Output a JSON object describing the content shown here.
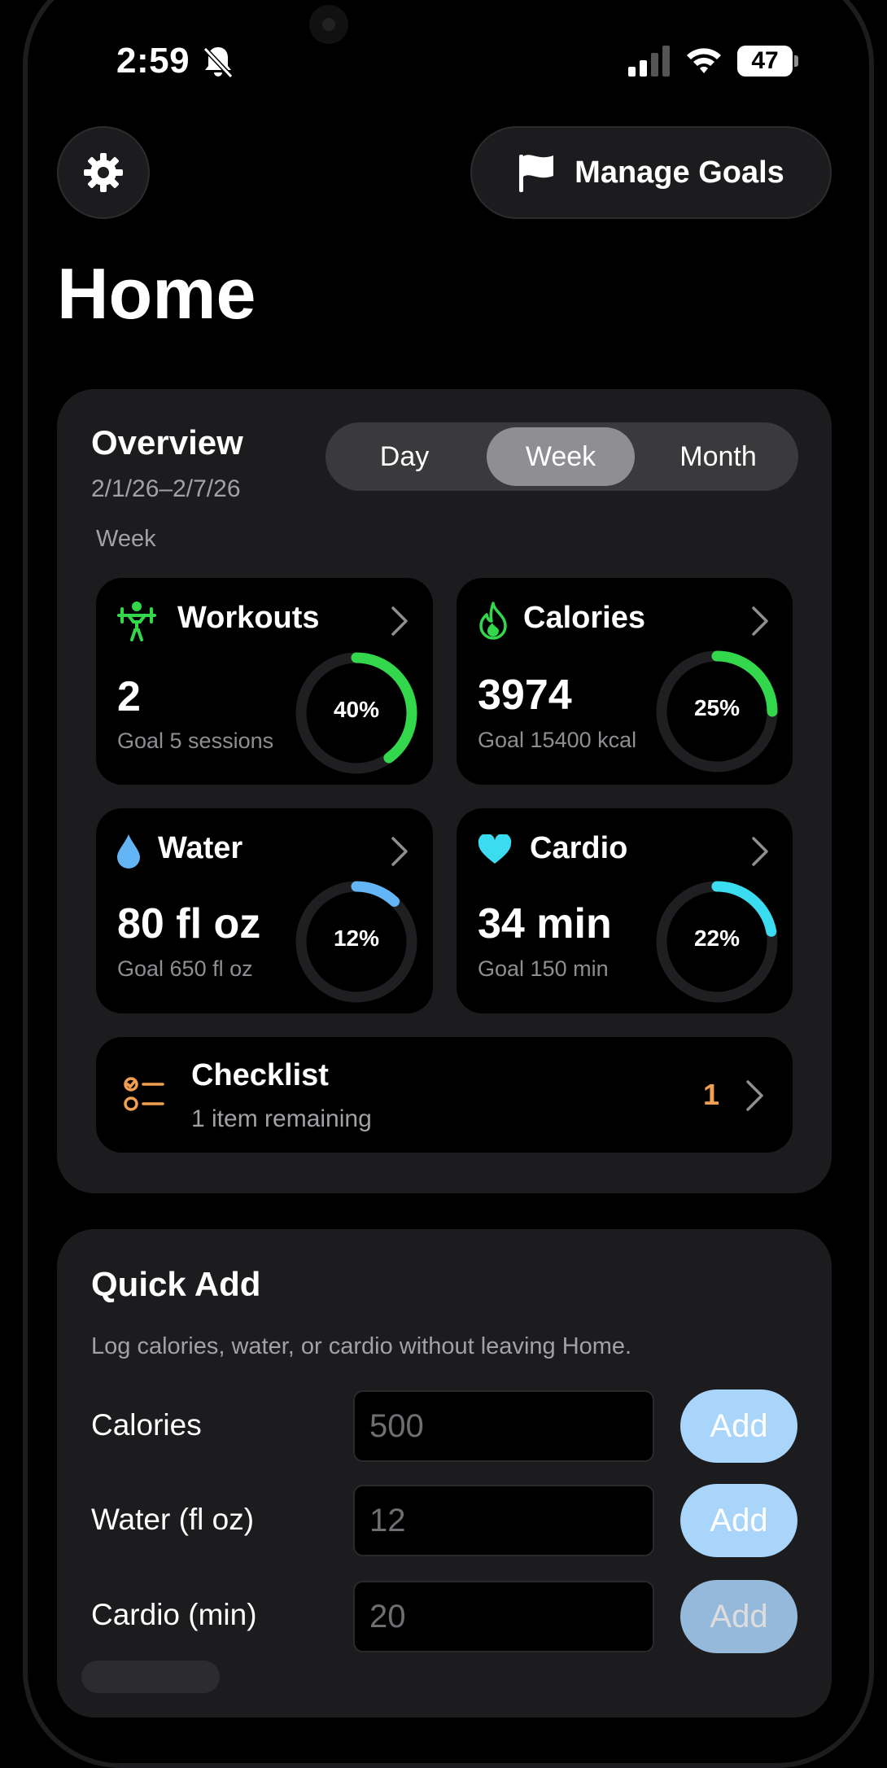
{
  "status_bar": {
    "time": "2:59",
    "battery": "47"
  },
  "header": {
    "settings_icon": "gear-icon",
    "manage_goals_label": "Manage Goals",
    "manage_goals_icon": "flag-icon"
  },
  "page_title": "Home",
  "overview": {
    "title": "Overview",
    "date_range": "2/1/26–2/7/26",
    "period_label": "Week",
    "segments": [
      "Day",
      "Week",
      "Month"
    ],
    "selected_segment": "Week",
    "tiles": {
      "workouts": {
        "title": "Workouts",
        "value": "2",
        "goal": "Goal 5 sessions",
        "percent_label": "40%",
        "progress": 0.4,
        "color": "#32d74b",
        "icon": "weightlifter-icon"
      },
      "calories": {
        "title": "Calories",
        "value": "3974",
        "goal": "Goal 15400 kcal",
        "percent_label": "25%",
        "progress": 0.25,
        "color": "#32d74b",
        "icon": "flame-icon"
      },
      "water": {
        "title": "Water",
        "value": "80 fl oz",
        "goal": "Goal 650 fl oz",
        "percent_label": "12%",
        "progress": 0.12,
        "color": "#64b5f6",
        "icon": "drop-icon"
      },
      "cardio": {
        "title": "Cardio",
        "value": "34 min",
        "goal": "Goal 150 min",
        "percent_label": "22%",
        "progress": 0.22,
        "color": "#3cdcf0",
        "icon": "heart-icon"
      }
    },
    "checklist": {
      "title": "Checklist",
      "subtitle": "1 item remaining",
      "count": "1",
      "count_color": "#f0a050",
      "icon": "checklist-icon"
    }
  },
  "quick_add": {
    "title": "Quick Add",
    "description": "Log calories, water, or cardio without leaving Home.",
    "rows": [
      {
        "label": "Calories",
        "placeholder": "500",
        "button": "Add"
      },
      {
        "label": "Water (fl oz)",
        "placeholder": "12",
        "button": "Add"
      },
      {
        "label": "Cardio (min)",
        "placeholder": "20",
        "button": "Add"
      }
    ]
  },
  "colors": {
    "background": "#000000",
    "card": "#1c1c1e",
    "accent_button": "#a9d5fb"
  }
}
